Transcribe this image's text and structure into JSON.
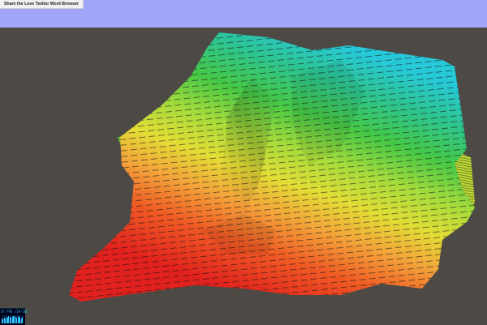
{
  "app": {
    "title": "Share the Love Twitter Word Browser"
  },
  "stats": {
    "fps_label": "57 FPS (19-58)",
    "history": [
      0.55,
      0.6,
      0.7,
      0.65,
      0.8,
      0.75,
      0.9,
      0.85,
      0.7,
      0.8,
      0.95,
      0.9,
      0.85,
      0.75,
      0.8,
      0.9,
      0.7,
      0.65,
      0.8
    ]
  },
  "colors": {
    "background": "#4d4a45",
    "top_bar": "#a2a6f8",
    "stats_text": "#2ec8ff",
    "terrain_low": "#e1211e",
    "terrain_high": "#27c9d8"
  }
}
